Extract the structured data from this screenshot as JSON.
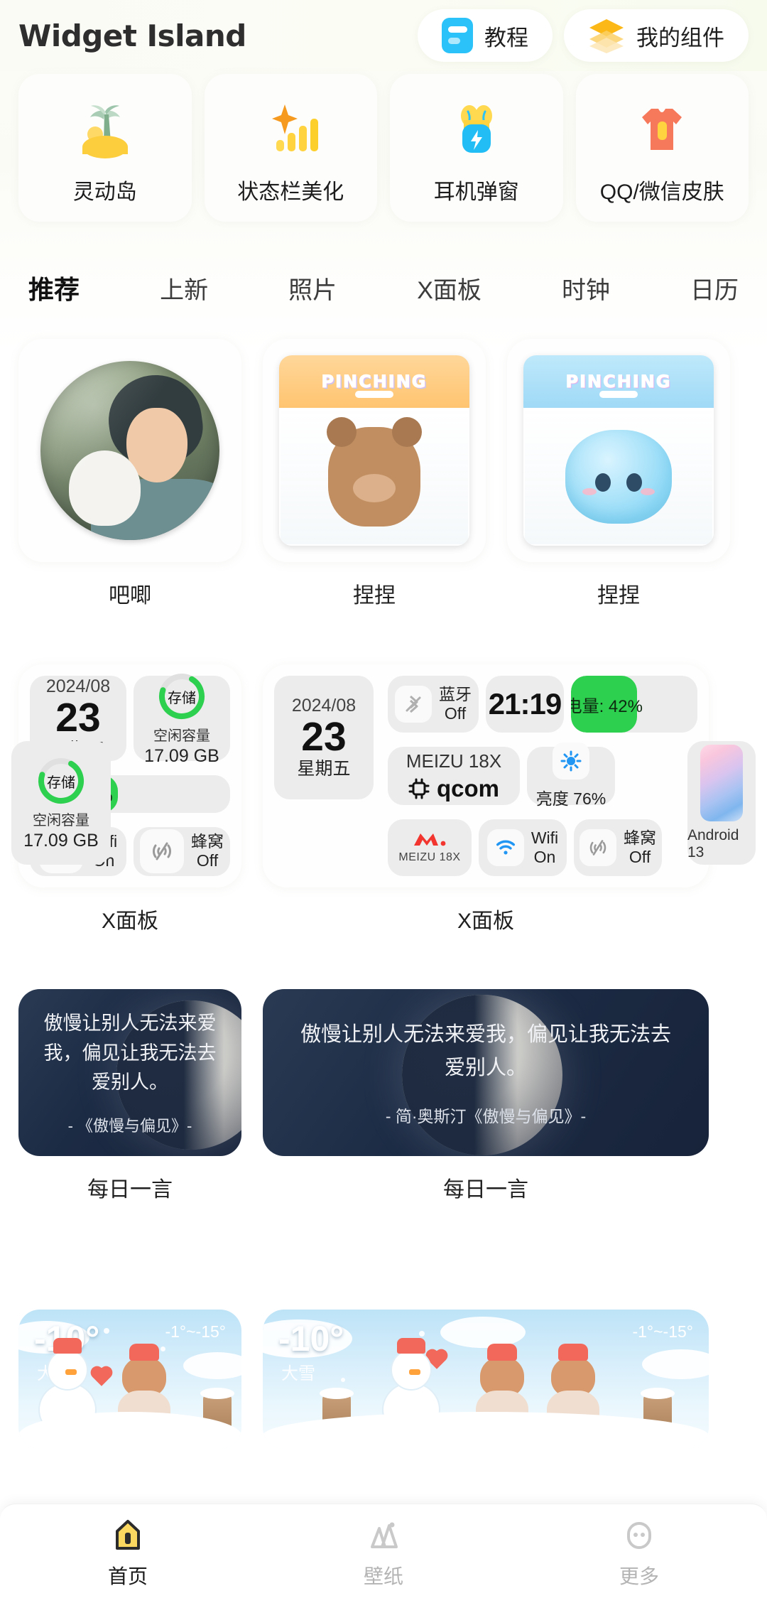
{
  "header": {
    "brand": "Widget Island",
    "tutorial": {
      "label": "教程",
      "icon": "tutorial-icon"
    },
    "my_widgets": {
      "label": "我的组件",
      "icon": "layers-icon"
    }
  },
  "categories": [
    {
      "label": "灵动岛",
      "icon": "island-icon"
    },
    {
      "label": "状态栏美化",
      "icon": "statusbar-icon"
    },
    {
      "label": "耳机弹窗",
      "icon": "earbuds-icon"
    },
    {
      "label": "QQ/微信皮肤",
      "icon": "tshirt-icon"
    }
  ],
  "tabs": [
    {
      "label": "推荐",
      "active": true
    },
    {
      "label": "上新",
      "active": false
    },
    {
      "label": "照片",
      "active": false
    },
    {
      "label": "X面板",
      "active": false
    },
    {
      "label": "时钟",
      "active": false
    },
    {
      "label": "日历",
      "active": false
    }
  ],
  "rows": {
    "photos": [
      {
        "caption": "吧唧"
      },
      {
        "caption": "捏捏",
        "pouch_title": "PINCHING"
      },
      {
        "caption": "捏捏",
        "pouch_title": "PINCHING"
      }
    ],
    "xpanel": {
      "small_caption": "X面板",
      "large_caption": "X面板",
      "date": {
        "year_month": "2024/08",
        "day": "23",
        "weekday": "星期五"
      },
      "storage": {
        "ring_label": "存储",
        "title": "空闲容量",
        "value": "17.09 GB",
        "percent": 72
      },
      "battery": {
        "text": "电量: 42%",
        "percent": 42
      },
      "wifi": {
        "name": "Wifi",
        "state": "On"
      },
      "cellular": {
        "name": "蜂窝",
        "state": "Off"
      },
      "bluetooth": {
        "name": "蓝牙",
        "state": "Off"
      },
      "clock": "21:19",
      "device": {
        "model": "MEIZU 18X",
        "soc": "qcom",
        "brand_label": "MEIZU 18X"
      },
      "brightness": {
        "label": "亮度",
        "value": "76%"
      },
      "wallpaper": {
        "label": "Android 13"
      }
    },
    "quotes": {
      "caption": "每日一言",
      "small": {
        "text": "傲慢让别人无法来爱我，偏见让我无法去爱别人。",
        "author": "- 《傲慢与偏见》-"
      },
      "large": {
        "text": "傲慢让别人无法来爱我，偏见让我无法去爱别人。",
        "author": "- 简·奥斯汀《傲慢与偏见》-"
      }
    },
    "weather": {
      "temp": "-10°",
      "condition": "大雪",
      "range": "-1°~-15°"
    }
  },
  "bottom_nav": [
    {
      "label": "首页",
      "icon": "home-icon",
      "active": true
    },
    {
      "label": "壁纸",
      "icon": "wallpaper-icon",
      "active": false
    },
    {
      "label": "更多",
      "icon": "more-icon",
      "active": false
    }
  ],
  "colors": {
    "accent_yellow": "#fbd960",
    "battery_green": "#2ed04f",
    "tutorial_blue": "#2ac2f8"
  }
}
